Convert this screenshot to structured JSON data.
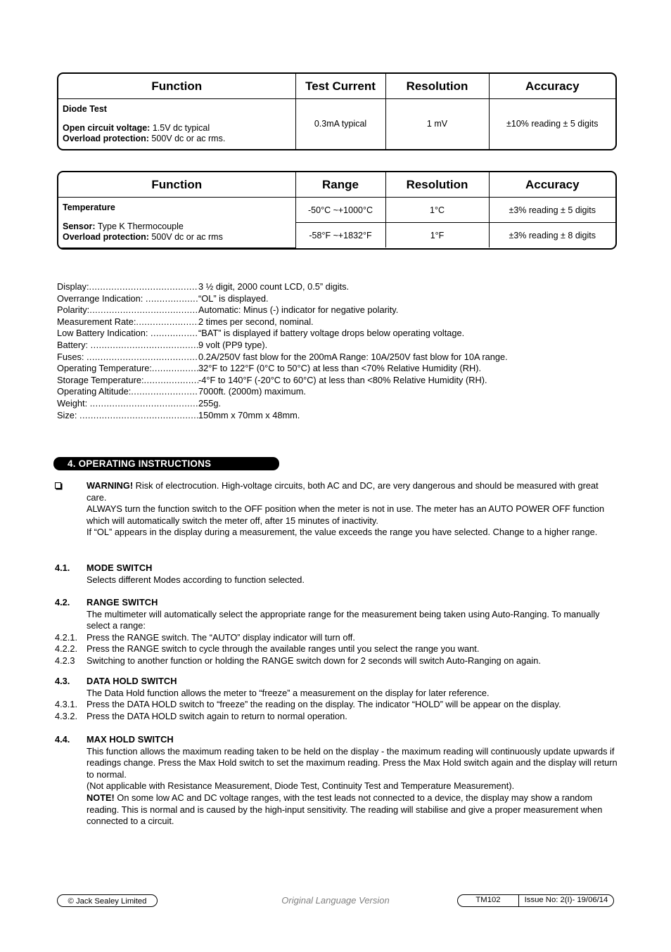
{
  "tables": [
    {
      "id": "diode",
      "headers": [
        "Function",
        "Test Current",
        "Resolution",
        "Accuracy"
      ],
      "function_cell": {
        "title": "Diode Test",
        "lines": [
          {
            "bold": "Open circuit voltage:",
            "text": " 1.5V dc typical"
          },
          {
            "bold": "Overload protection:",
            "text": " 500V dc or ac rms."
          }
        ]
      },
      "rows": [
        {
          "test_current": "0.3mA typical",
          "resolution": "1 mV",
          "accuracy": "±10% reading ± 5 digits"
        }
      ]
    },
    {
      "id": "temperature",
      "headers": [
        "Function",
        "Range",
        "Resolution",
        "Accuracy"
      ],
      "function_cell": {
        "title": "Temperature",
        "lines": [
          {
            "bold": "Sensor:",
            "text": " Type K Thermocouple"
          },
          {
            "bold": "Overload protection:",
            "text": " 500V dc or ac rms"
          }
        ]
      },
      "rows": [
        {
          "range": "-50°C ~+1000°C",
          "resolution": "1°C",
          "accuracy": "±3% reading ± 5 digits"
        },
        {
          "range": "-58°F ~+1832°F",
          "resolution": "1°F",
          "accuracy": "±3% reading ± 8 digits"
        }
      ]
    }
  ],
  "specifications": [
    {
      "label": "Display:",
      "value": "3 ½ digit, 2000 count LCD, 0.5” digits."
    },
    {
      "label": "Overrange Indication: ",
      "value": "“OL” is displayed."
    },
    {
      "label": "Polarity:",
      "value": "Automatic: Minus (-) indicator for negative polarity."
    },
    {
      "label": "Measurement Rate:",
      "value": "2 times per second, nominal."
    },
    {
      "label": "Low Battery Indication: ",
      "value": "“BAT” is displayed if battery voltage drops below operating voltage."
    },
    {
      "label": "Battery: ",
      "value": "9 volt (PP9 type)."
    },
    {
      "label": "Fuses: ",
      "value": "0.2A/250V fast blow for the 200mA Range: 10A/250V fast blow for 10A range."
    },
    {
      "label": "Operating Temperature:",
      "value": "32°F to 122°F (0°C to 50°C) at less than <70% Relative Humidity (RH)."
    },
    {
      "label": "Storage Temperature:",
      "value": "-4°F to 140°F (-20°C to 60°C) at less than <80% Relative Humidity (RH)."
    },
    {
      "label": "Operating Altitude:",
      "value": "7000ft. (2000m) maximum."
    },
    {
      "label": "Weight:  ",
      "value": "255g."
    },
    {
      "label": "Size:   ",
      "value": "150mm x 70mm x 48mm."
    }
  ],
  "section": {
    "number": "4.",
    "title": "OPERATING INSTRUCTIONS",
    "heading_label": "4.  OPERATING INSTRUCTIONS"
  },
  "warning": {
    "icon": "square-bullet-icon",
    "label": "WARNING!",
    "para1": "  Risk of electrocution. High-voltage circuits, both AC and DC, are very dangerous and should be measured with great care.",
    "para2": "ALWAYS turn the function switch to the OFF position when the meter is not in use. The meter has an AUTO POWER OFF function which will automatically switch the meter off, after 15 minutes of inactivity.",
    "para3": "If “OL” appears in the display during a measurement, the value exceeds the range you have selected. Change to a higher range."
  },
  "subsections": [
    {
      "number": "4.1.",
      "title": "MODE SWITCH",
      "body": "Selects different Modes according to function selected.",
      "items": []
    },
    {
      "number": "4.2.",
      "title": "RANGE SWITCH",
      "body": "The multimeter will automatically select the appropriate range for the measurement being taken using Auto-Ranging. To manually select a range:",
      "items": [
        {
          "number": "4.2.1.",
          "text": "Press the RANGE switch. The “AUTO” display indicator will turn off."
        },
        {
          "number": "4.2.2.",
          "text": "Press the RANGE switch to cycle through the available ranges until you select the range you want."
        },
        {
          "number": "4.2.3",
          "text": "Switching to another function or holding the RANGE switch down for 2 seconds will switch Auto-Ranging on again."
        }
      ]
    },
    {
      "number": "4.3.",
      "title": "DATA HOLD SWITCH",
      "body": "The Data Hold function allows the meter to “freeze” a measurement on the display for later reference.",
      "items": [
        {
          "number": "4.3.1.",
          "text": "Press the DATA HOLD switch to “freeze” the reading on the display. The indicator “HOLD” will be appear on the display."
        },
        {
          "number": "4.3.2.",
          "text": "Press the DATA HOLD switch again to return to normal operation."
        }
      ]
    },
    {
      "number": "4.4.",
      "title": "MAX HOLD SWITCH",
      "body": "This function allows the maximum reading taken to be held on the display - the maximum reading will continuously update upwards if readings change. Press the Max Hold switch to set the maximum reading. Press the Max Hold switch again and the display will return to normal.",
      "body2": "(Not applicable with Resistance Measurement, Diode Test, Continuity Test and Temperature Measurement).",
      "note_label": "NOTE!",
      "note_text": " On some low AC and DC voltage ranges, with the test leads not connected to a device, the display may show a random reading. This is normal and is caused by the high-input sensitivity. The reading will stabilise and give a proper measurement when connected to a circuit.",
      "items": []
    }
  ],
  "footer": {
    "copyright": "© Jack Sealey Limited",
    "center_note": "Original Language Version",
    "model": "TM102",
    "issue": "Issue No: 2(I)- 19/06/14"
  }
}
